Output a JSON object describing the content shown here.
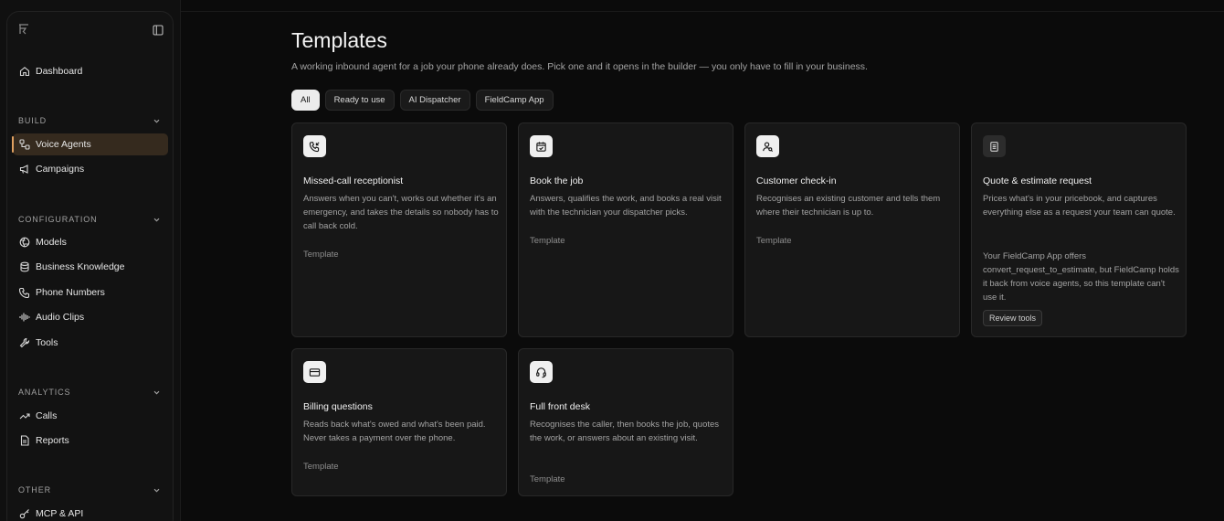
{
  "sidebar": {
    "items": {
      "dashboard": "Dashboard",
      "voice_agents": "Voice Agents",
      "campaigns": "Campaigns",
      "models": "Models",
      "business_knowledge": "Business Knowledge",
      "phone_numbers": "Phone Numbers",
      "audio_clips": "Audio Clips",
      "tools": "Tools",
      "calls": "Calls",
      "reports": "Reports",
      "mcp_api": "MCP & API"
    },
    "sections": {
      "build": "BUILD",
      "configuration": "CONFIGURATION",
      "analytics": "ANALYTICS",
      "other": "OTHER"
    },
    "active_item": "Voice Agents",
    "accent_color": "#e0a060"
  },
  "main": {
    "title": "Templates",
    "subtitle": "A working inbound agent for a job your phone already does. Pick one and it opens in the builder — you only have to fill in your business.",
    "filters": [
      "All",
      "Ready to use",
      "AI Dispatcher",
      "FieldCamp App"
    ],
    "active_filter": "All",
    "cards": [
      {
        "icon": "phone-incoming-icon",
        "title": "Missed-call receptionist",
        "description": "Answers when you can't, works out whether it's an emergency, and takes the details so nobody has to call back cold.",
        "meta": "Template"
      },
      {
        "icon": "calendar-check-icon",
        "title": "Book the job",
        "description": "Answers, qualifies the work, and books a real visit with the technician your dispatcher picks.",
        "meta": "Template"
      },
      {
        "icon": "user-search-icon",
        "title": "Customer check-in",
        "description": "Recognises an existing customer and tells them where their technician is up to.",
        "meta": "Template"
      },
      {
        "icon": "document-icon",
        "title": "Quote & estimate request",
        "description": "Prices what's in your pricebook, and captures everything else as a request your team can quote.",
        "note": "Your FieldCamp App offers convert_request_to_estimate, but FieldCamp holds it back from voice agents, so this template can't use it.",
        "button": "Review tools"
      },
      {
        "icon": "credit-card-icon",
        "title": "Billing questions",
        "description": "Reads back what's owed and what's been paid. Never takes a payment over the phone.",
        "meta": "Template"
      },
      {
        "icon": "headset-icon",
        "title": "Full front desk",
        "description": "Recognises the caller, then books the job, quotes the work, or answers about an existing visit.",
        "meta": "Template"
      }
    ]
  }
}
